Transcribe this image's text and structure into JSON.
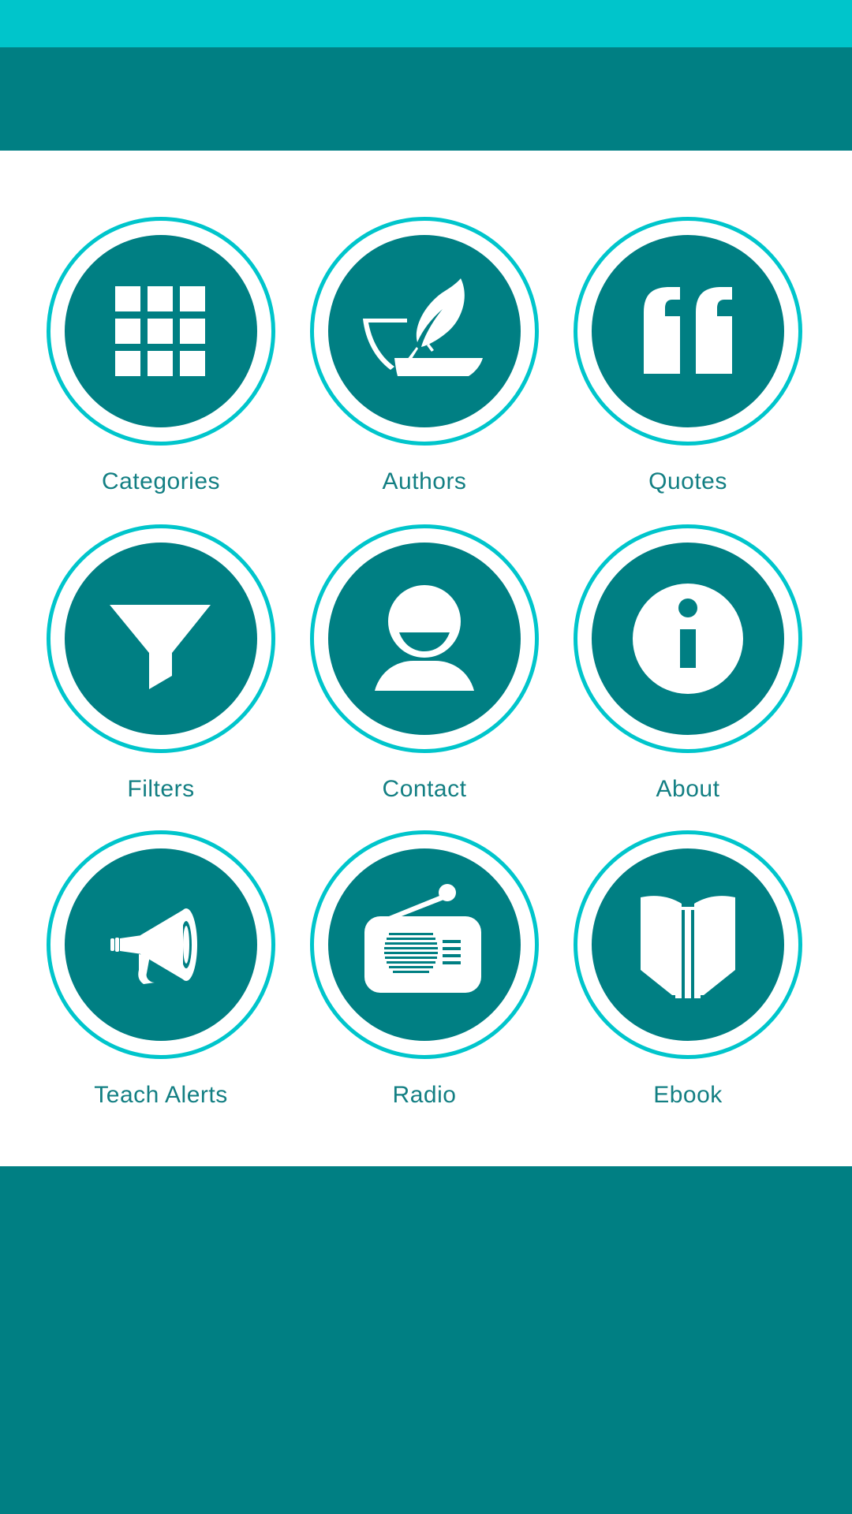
{
  "colors": {
    "status_bar": "#00c5cb",
    "app_bar": "#007f83",
    "footer": "#007f83",
    "content_bg": "#ffffff",
    "ring": "#00c5cb",
    "disc": "#007f83",
    "icon": "#ffffff",
    "label": "#137f83"
  },
  "menu": {
    "items": [
      {
        "label": "Categories",
        "icon": "grid-icon"
      },
      {
        "label": "Authors",
        "icon": "quill-inkpot-icon"
      },
      {
        "label": "Quotes",
        "icon": "quote-icon"
      },
      {
        "label": "Filters",
        "icon": "funnel-icon"
      },
      {
        "label": "Contact",
        "icon": "person-icon"
      },
      {
        "label": "About",
        "icon": "info-icon"
      },
      {
        "label": "Teach Alerts",
        "icon": "megaphone-icon"
      },
      {
        "label": "Radio",
        "icon": "radio-icon"
      },
      {
        "label": "Ebook",
        "icon": "book-icon"
      }
    ]
  }
}
